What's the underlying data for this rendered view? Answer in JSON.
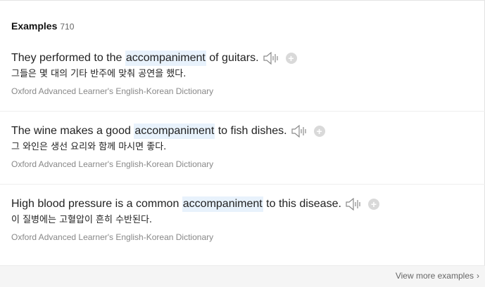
{
  "header": {
    "title": "Examples",
    "count": "710"
  },
  "examples": [
    {
      "en_before": "They performed to the ",
      "en_highlight": "accompaniment",
      "en_after": " of guitars.",
      "ko": "그들은 몇 대의 기타 반주에 맞춰 공연을 했다.",
      "source": "Oxford Advanced Learner's English-Korean Dictionary"
    },
    {
      "en_before": "The wine makes a good ",
      "en_highlight": "accompaniment",
      "en_after": " to fish dishes.",
      "ko": "그 와인은 생선 요리와 함께 마시면 좋다.",
      "source": "Oxford Advanced Learner's English-Korean Dictionary"
    },
    {
      "en_before": "High blood pressure is a common ",
      "en_highlight": "accompaniment",
      "en_after": " to this disease.",
      "ko": "이 질병에는 고혈압이 흔히 수반된다.",
      "source": "Oxford Advanced Learner's English-Korean Dictionary"
    }
  ],
  "icons": {
    "speaker": "speaker-icon",
    "add": "plus-icon",
    "more": "chevron-right-icon"
  },
  "plus_glyph": "+",
  "footer": {
    "more_label": "View more examples",
    "chevron": "›"
  },
  "colors": {
    "highlight": "#e8f2fc",
    "source_text": "#888888",
    "icon_gray": "#d9d9d9"
  }
}
